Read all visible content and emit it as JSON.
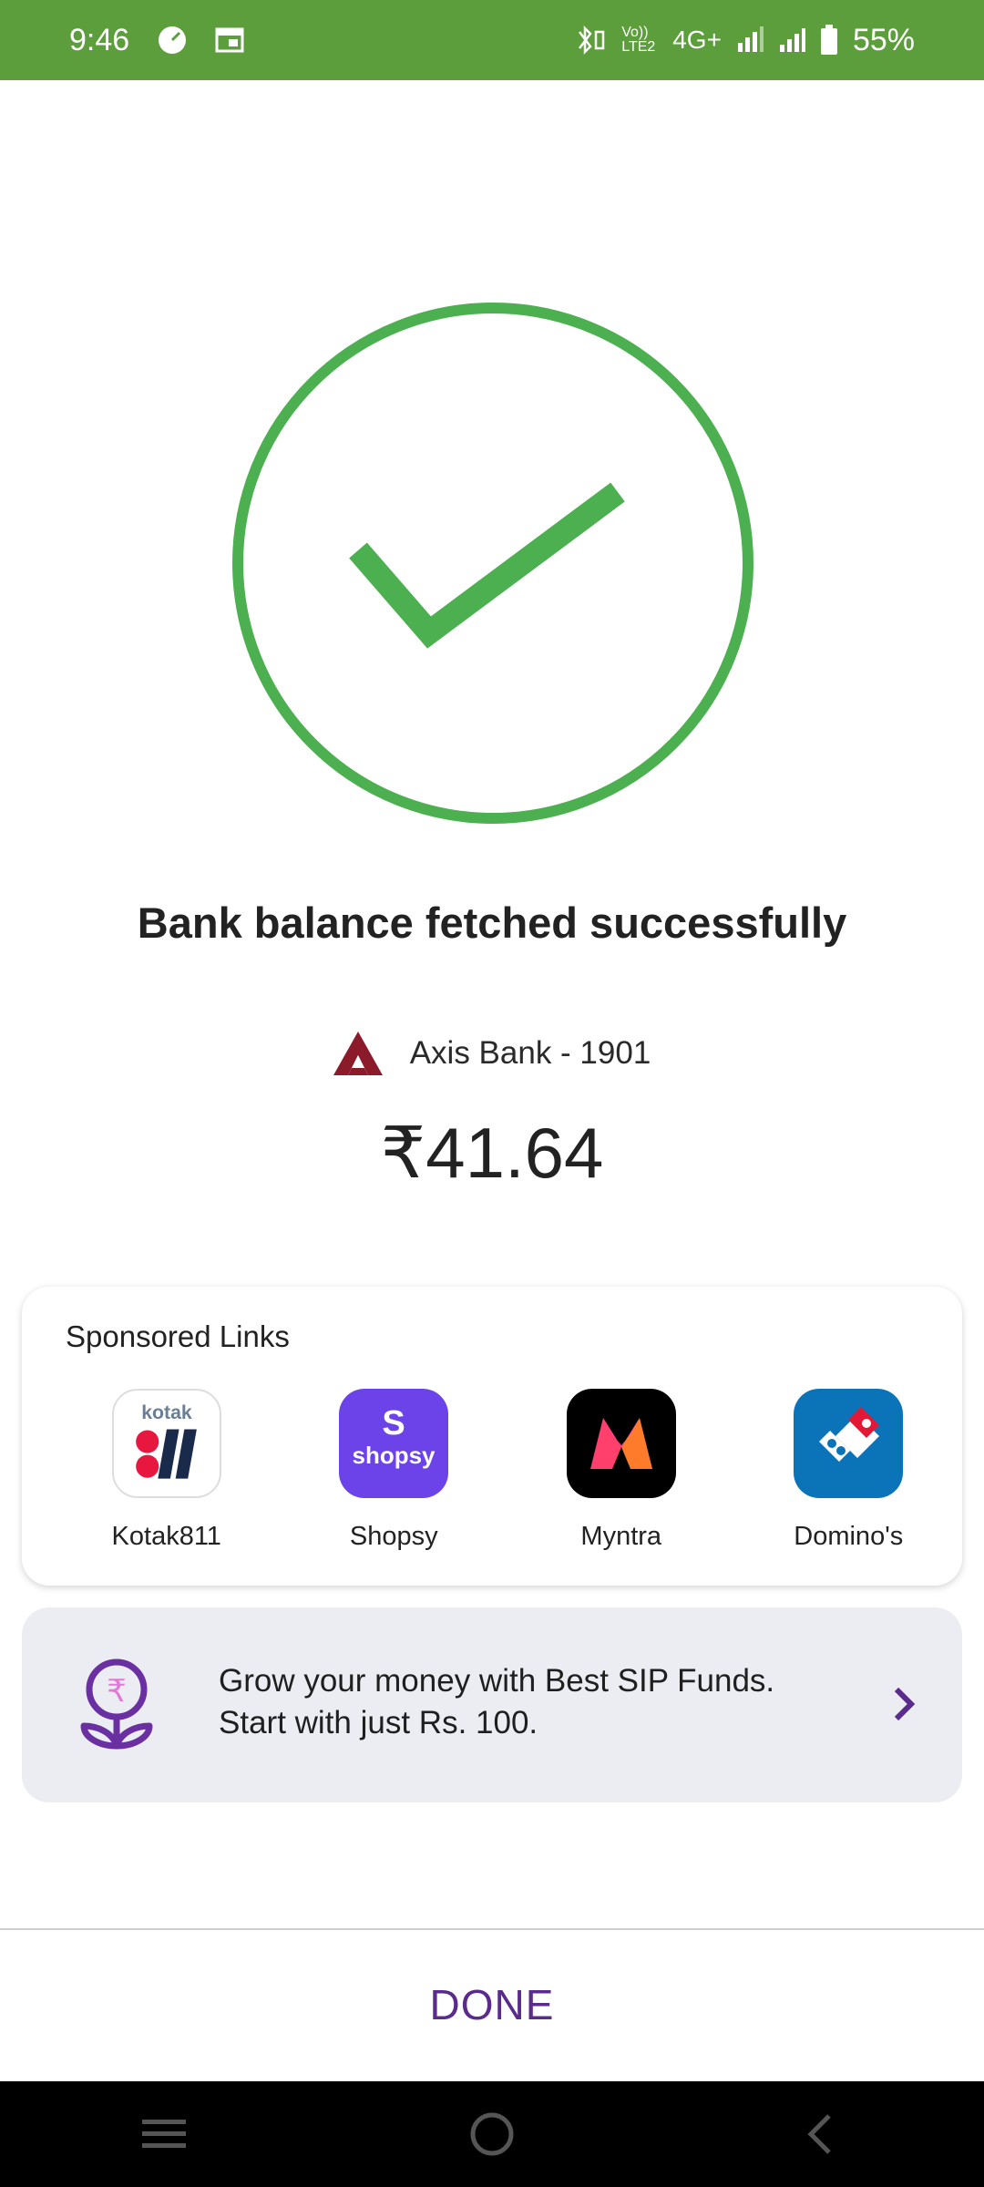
{
  "status_bar": {
    "time": "9:46",
    "network_label": "4G+",
    "volte_label": "Vo)) LTE2",
    "battery": "55%"
  },
  "result": {
    "title": "Bank balance fetched successfully",
    "bank_name": "Axis Bank - 1901",
    "balance": "₹41.64"
  },
  "sponsored": {
    "title": "Sponsored Links",
    "apps": [
      {
        "label": "Kotak811",
        "icon": "kotak811-icon"
      },
      {
        "label": "Shopsy",
        "icon": "shopsy-icon"
      },
      {
        "label": "Myntra",
        "icon": "myntra-icon"
      },
      {
        "label": "Domino's",
        "icon": "dominos-icon"
      }
    ]
  },
  "sip_banner": {
    "line1": "Grow your money with Best SIP Funds.",
    "line2": "Start with just Rs. 100."
  },
  "done_label": "DONE",
  "colors": {
    "status_bar": "#5c9e3b",
    "success_green": "#4caf50",
    "accent_purple": "#5a2a8c"
  }
}
